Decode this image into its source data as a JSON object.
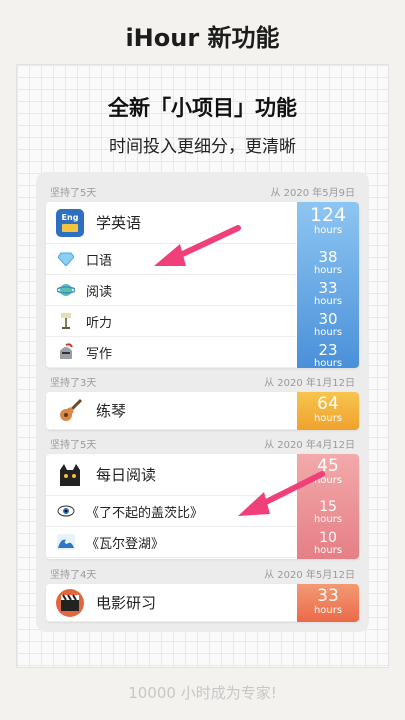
{
  "app_title": "iHour 新功能",
  "headline": "全新「小项目」功能",
  "subline": "时间投入更细分，更清晰",
  "footer": "10000 小时成为专家!",
  "groups": [
    {
      "streak": "坚持了5天",
      "since": "从 2020 年5月9日",
      "color_top": "#8ec6f2",
      "color_bottom": "#4a90d9",
      "main": {
        "label": "学英语",
        "hours": "124",
        "unit": "hours",
        "icon": "english-book-icon",
        "icon_text": "Eng"
      },
      "subs": [
        {
          "label": "口语",
          "hours": "38",
          "unit": "hours",
          "icon": "diamond-icon"
        },
        {
          "label": "阅读",
          "hours": "33",
          "unit": "hours",
          "icon": "planet-icon"
        },
        {
          "label": "听力",
          "hours": "30",
          "unit": "hours",
          "icon": "lamp-icon"
        },
        {
          "label": "写作",
          "hours": "23",
          "unit": "hours",
          "icon": "helmet-icon"
        }
      ]
    },
    {
      "streak": "坚持了3天",
      "since": "从 2020 年1月12日",
      "color_top": "#f7c54e",
      "color_bottom": "#efa22e",
      "main": {
        "label": "练琴",
        "hours": "64",
        "unit": "hours",
        "icon": "guitar-icon"
      },
      "subs": []
    },
    {
      "streak": "坚持了5天",
      "since": "从 2020 年4月12日",
      "color_top": "#f2aaaa",
      "color_bottom": "#e57f86",
      "main": {
        "label": "每日阅读",
        "hours": "45",
        "unit": "hours",
        "icon": "black-cat-icon"
      },
      "subs": [
        {
          "label": "《了不起的盖茨比》",
          "hours": "15",
          "unit": "hours",
          "icon": "eye-icon"
        },
        {
          "label": "《瓦尔登湖》",
          "hours": "10",
          "unit": "hours",
          "icon": "wave-icon"
        }
      ]
    },
    {
      "streak": "坚持了4天",
      "since": "从 2020 年5月12日",
      "color_top": "#f39a75",
      "color_bottom": "#ea6a48",
      "main": {
        "label": "电影研习",
        "hours": "33",
        "unit": "hours",
        "icon": "clapperboard-icon"
      },
      "subs": []
    }
  ]
}
